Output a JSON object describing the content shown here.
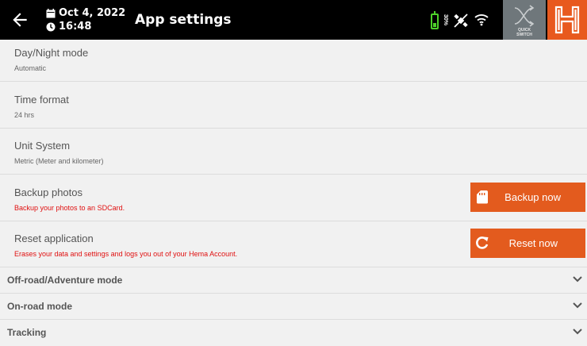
{
  "header": {
    "date": "Oct 4, 2022",
    "time": "16:48",
    "title": "App settings",
    "battery_level": "30%",
    "quick_switch_label_1": "QUICK",
    "quick_switch_label_2": "SWITCH",
    "icons": {
      "back": "back-arrow-icon",
      "calendar": "calendar-icon",
      "clock": "clock-icon",
      "battery": "battery-icon",
      "gps": "gps-off-icon",
      "wifi": "wifi-icon",
      "quick_switch": "quick-switch-icon",
      "brand": "hema-logo-icon"
    },
    "colors": {
      "battery": "#4dd22a",
      "brand": "#e8591e"
    }
  },
  "settings": {
    "day_night": {
      "title": "Day/Night mode",
      "value": "Automatic"
    },
    "time_format": {
      "title": "Time format",
      "value": "24 hrs"
    },
    "unit_system": {
      "title": "Unit System",
      "value": "Metric (Meter and kilometer)"
    },
    "backup": {
      "title": "Backup photos",
      "description": "Backup your photos to an SDCard.",
      "button": "Backup now",
      "icon": "sd-card-icon"
    },
    "reset": {
      "title": "Reset application",
      "description": "Erases your data and settings and logs you out of your Hema Account.",
      "button": "Reset now",
      "icon": "refresh-icon"
    }
  },
  "sections": [
    {
      "label": "Off-road/Adventure mode"
    },
    {
      "label": "On-road mode"
    },
    {
      "label": "Tracking"
    }
  ],
  "accent_color": "#e35b1e",
  "warning_color": "#e01010"
}
